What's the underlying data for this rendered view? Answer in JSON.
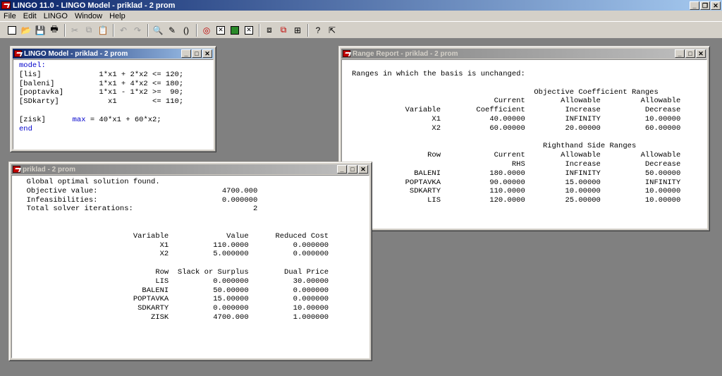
{
  "app": {
    "title": "LINGO 11.0 - LINGO Model - priklad - 2 prom",
    "caption_buttons": {
      "minimize": "_",
      "restore": "❐",
      "close": "✕"
    }
  },
  "menu": {
    "items": [
      "File",
      "Edit",
      "LINGO",
      "Window",
      "Help"
    ]
  },
  "toolbar": {
    "icons": [
      "new-file-icon",
      "open-folder-icon",
      "save-icon",
      "print-icon",
      "cut-icon",
      "copy-icon",
      "paste-icon",
      "undo-icon",
      "redo-icon",
      "find-icon",
      "find-next-icon",
      "match-parenthesis-icon",
      "solve-icon",
      "solution-icon",
      "options-icon",
      "close-all-icon",
      "send-to-back-icon",
      "tile-icon",
      "cascade-icon",
      "help-icon",
      "context-help-icon"
    ]
  },
  "model_window": {
    "title": "LINGO Model - priklad - 2 prom",
    "lines": [
      {
        "kw": "model:",
        "text": ""
      },
      {
        "kw": "",
        "text": "[lis]             1*x1 + 2*x2 <= 120;"
      },
      {
        "kw": "",
        "text": "[baleni]          1*x1 + 4*x2 <= 180;"
      },
      {
        "kw": "",
        "text": "[poptavka]        1*x1 - 1*x2 >=  90;"
      },
      {
        "kw": "",
        "text": "[SDkarty]           x1        <= 110;"
      },
      {
        "kw": "",
        "text": ""
      },
      {
        "kw": "",
        "text": "[zisk]      ",
        "kw2": "max",
        "rest": " = 40*x1 + 60*x2;"
      },
      {
        "kw": "end",
        "text": ""
      }
    ]
  },
  "solution_window": {
    "title": "priklad - 2 prom",
    "status": "Global optimal solution found.",
    "objective_label": "Objective value:",
    "objective_value": "4700.000",
    "infeasibilities_label": "Infeasibilities:",
    "infeasibilities_value": "0.000000",
    "iterations_label": "Total solver iterations:",
    "iterations_value": "2",
    "var_headers": [
      "Variable",
      "Value",
      "Reduced Cost"
    ],
    "variables": [
      [
        "X1",
        "110.0000",
        "0.000000"
      ],
      [
        "X2",
        "5.000000",
        "0.000000"
      ]
    ],
    "row_headers": [
      "Row",
      "Slack or Surplus",
      "Dual Price"
    ],
    "rows": [
      [
        "LIS",
        "0.000000",
        "30.00000"
      ],
      [
        "BALENI",
        "50.00000",
        "0.000000"
      ],
      [
        "POPTAVKA",
        "15.00000",
        "0.000000"
      ],
      [
        "SDKARTY",
        "0.000000",
        "10.00000"
      ],
      [
        "ZISK",
        "4700.000",
        "1.000000"
      ]
    ]
  },
  "range_window": {
    "title": "Range Report - priklad - 2 prom",
    "intro": "Ranges in which the basis is unchanged:",
    "obj_section_title": "Objective Coefficient Ranges",
    "obj_headers_top": [
      "",
      "Current",
      "Allowable",
      "Allowable"
    ],
    "obj_headers_bottom": [
      "Variable",
      "Coefficient",
      "Increase",
      "Decrease"
    ],
    "obj_rows": [
      [
        "X1",
        "40.00000",
        "INFINITY",
        "10.00000"
      ],
      [
        "X2",
        "60.00000",
        "20.00000",
        "60.00000"
      ]
    ],
    "rhs_section_title": "Righthand Side Ranges",
    "rhs_headers_top": [
      "Row",
      "Current",
      "Allowable",
      "Allowable"
    ],
    "rhs_headers_bottom": [
      "",
      "RHS",
      "Increase",
      "Decrease"
    ],
    "rhs_rows": [
      [
        "BALENI",
        "180.0000",
        "INFINITY",
        "50.00000"
      ],
      [
        "POPTAVKA",
        "90.00000",
        "15.00000",
        "INFINITY"
      ],
      [
        "SDKARTY",
        "110.0000",
        "10.00000",
        "10.00000"
      ],
      [
        "LIS",
        "120.0000",
        "25.00000",
        "10.00000"
      ]
    ]
  }
}
